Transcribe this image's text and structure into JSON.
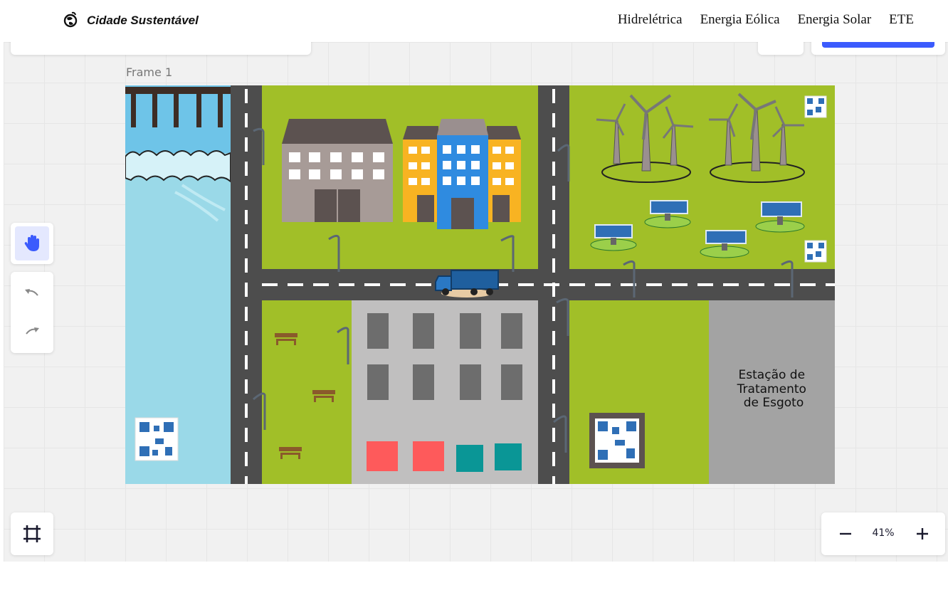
{
  "brand": {
    "title": "Cidade Sustentável",
    "logo_icon": "globe-leaf-icon"
  },
  "nav": {
    "items": [
      "Hidrelétrica",
      "Energia Eólica",
      "Energia Solar",
      "ETE"
    ]
  },
  "canvas": {
    "frame_label": "Frame 1",
    "zoom": "41%"
  },
  "map": {
    "ete_label": "Estação de\nTratamento\nde Esgoto"
  },
  "colors": {
    "accent": "#3b5bfd",
    "grass": "#a1bf28",
    "road": "#4d4d4d",
    "water": "#9ad9e8",
    "ete_area": "#a3a3a3"
  },
  "toolbar": {
    "hand_icon": "hand-icon",
    "undo_icon": "undo-icon",
    "redo_icon": "redo-icon",
    "frame_icon": "frame-icon",
    "zoom_out_icon": "minus-icon",
    "zoom_in_icon": "plus-icon"
  }
}
